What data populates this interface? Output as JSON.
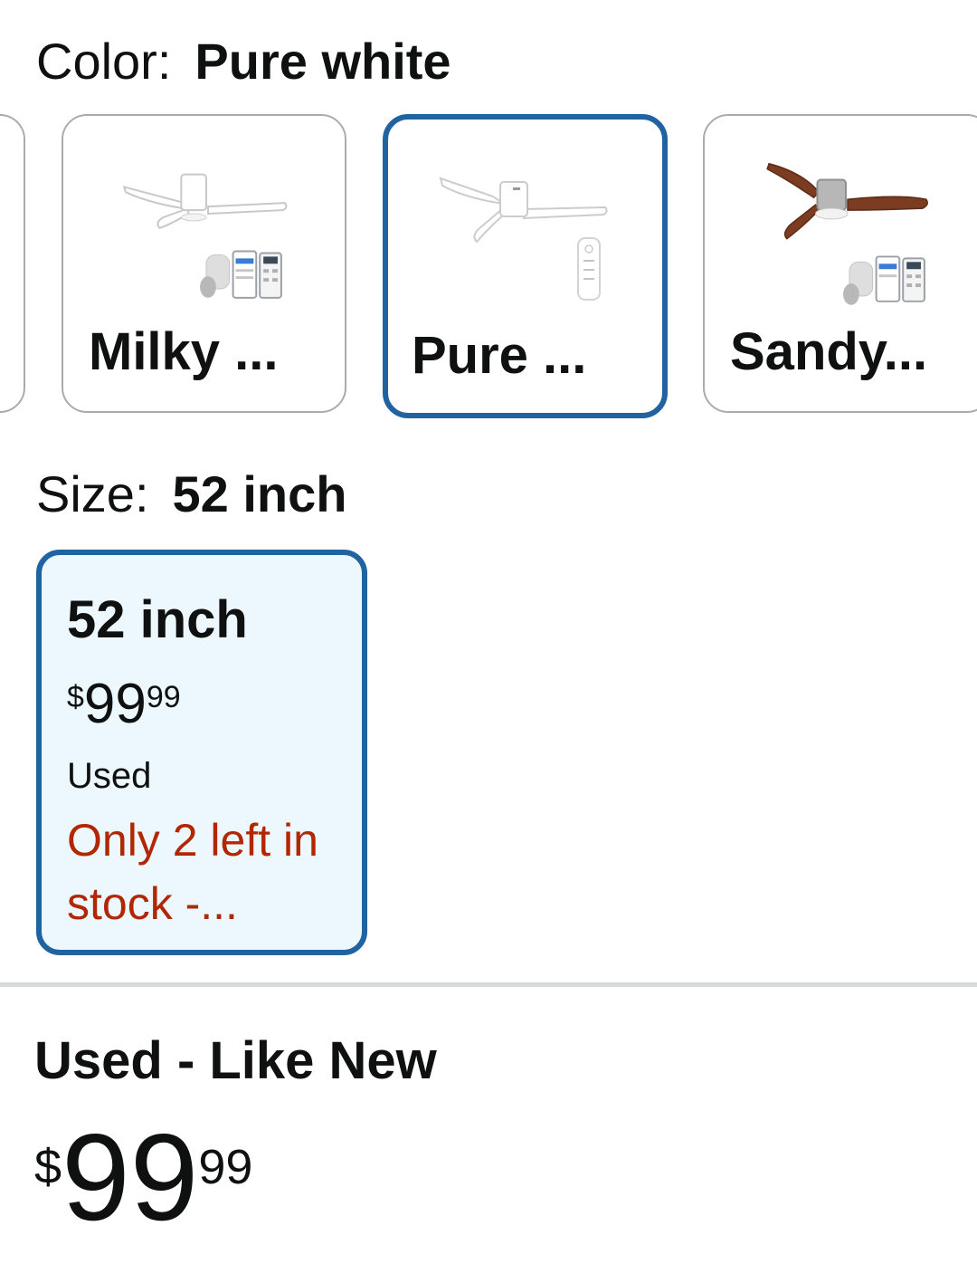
{
  "color_selector": {
    "label": "Color:",
    "selected_value": "Pure white",
    "options": [
      {
        "name": "Milky ...",
        "icon": "ceiling-fan-with-smart-speaker-phone-and-remote",
        "selected": false
      },
      {
        "name": "Pure ...",
        "icon": "ceiling-fan-with-remote",
        "selected": true
      },
      {
        "name": "Sandy...",
        "icon": "wood-ceiling-fan-with-smart-speaker-phone-and-remote",
        "selected": false
      }
    ]
  },
  "size_selector": {
    "label": "Size:",
    "selected_value": "52 inch",
    "options": [
      {
        "title": "52 inch",
        "price_symbol": "$",
        "price_whole": "99",
        "price_fraction": "99",
        "condition": "Used",
        "stock": "Only 2 left in stock -...",
        "selected": true
      }
    ]
  },
  "offer": {
    "condition": "Used - Like New",
    "price_symbol": "$",
    "price_whole": "99",
    "price_fraction": "99"
  },
  "colors": {
    "selected_border": "#2162a1",
    "selected_card_bg": "#edf7fe",
    "stock_warning": "#b12704",
    "unselected_border": "#a9abac"
  }
}
